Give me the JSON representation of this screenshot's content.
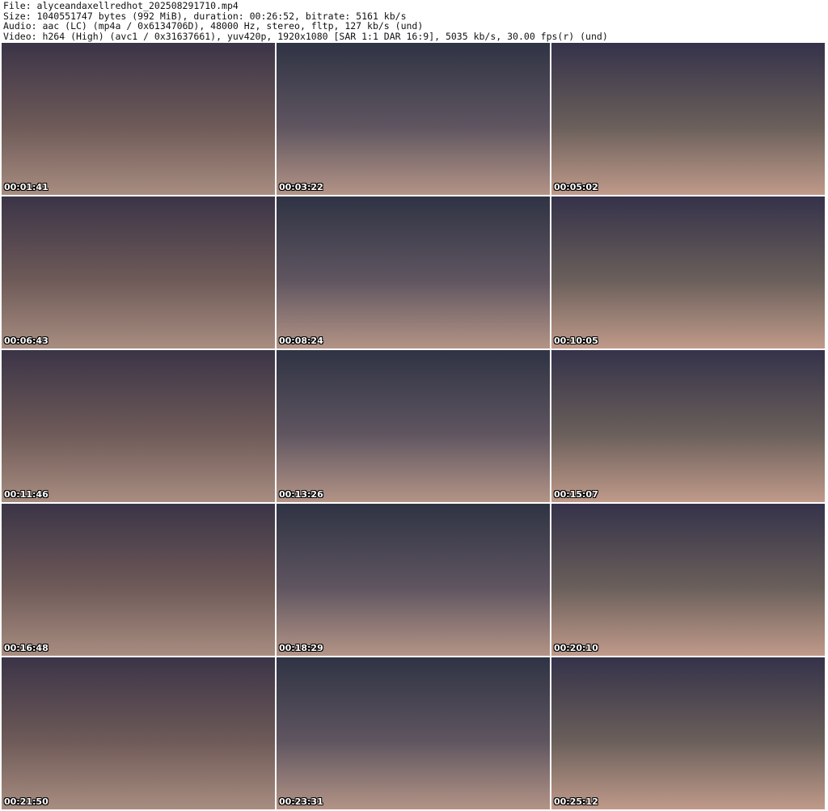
{
  "header": {
    "file": "File: alyceandaxellredhot_202508291710.mp4",
    "size": "Size: 1040551747 bytes (992 MiB), duration: 00:26:52, bitrate: 5161 kb/s",
    "audio": "Audio: aac (LC) (mp4a / 0x6134706D), 48000 Hz, stereo, fltp, 127 kb/s (und)",
    "video": "Video: h264 (High) (avc1 / 0x31637661), yuv420p, 1920x1080 [SAR 1:1 DAR 16:9], 5035 kb/s, 30.00 fps(r) (und)"
  },
  "thumbnails": [
    {
      "timestamp": "00:01:41"
    },
    {
      "timestamp": "00:03:22"
    },
    {
      "timestamp": "00:05:02"
    },
    {
      "timestamp": "00:06:43"
    },
    {
      "timestamp": "00:08:24"
    },
    {
      "timestamp": "00:10:05"
    },
    {
      "timestamp": "00:11:46"
    },
    {
      "timestamp": "00:13:26"
    },
    {
      "timestamp": "00:15:07"
    },
    {
      "timestamp": "00:16:48"
    },
    {
      "timestamp": "00:18:29"
    },
    {
      "timestamp": "00:20:10"
    },
    {
      "timestamp": "00:21:50"
    },
    {
      "timestamp": "00:23:31"
    },
    {
      "timestamp": "00:25:12"
    }
  ]
}
